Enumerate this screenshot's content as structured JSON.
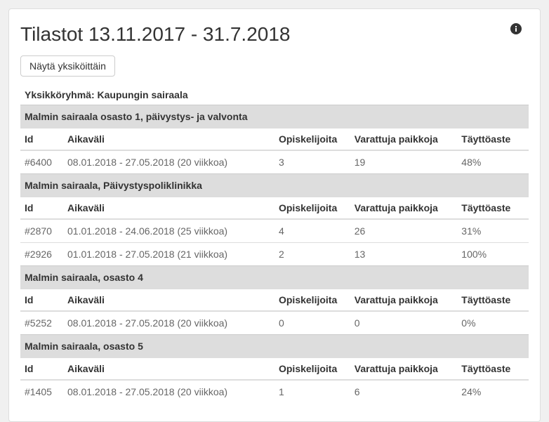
{
  "page": {
    "title": "Tilastot 13.11.2017 - 31.7.2018",
    "buttons": {
      "show_by_unit": "Näytä yksiköittäin"
    },
    "group_label": "Yksikköryhmä: Kaupungin sairaala"
  },
  "columns": {
    "id": "Id",
    "period": "Aikaväli",
    "students": "Opiskelijoita",
    "reserved": "Varattuja paikkoja",
    "fill": "Täyttöaste"
  },
  "sections": [
    {
      "name": "Malmin sairaala osasto 1, päivystys- ja valvonta",
      "rows": [
        {
          "id": "#6400",
          "period": "08.01.2018 - 27.05.2018 (20 viikkoa)",
          "students": "3",
          "reserved": "19",
          "fill": "48%"
        }
      ]
    },
    {
      "name": "Malmin sairaala, Päivystyspoliklinikka",
      "rows": [
        {
          "id": "#2870",
          "period": "01.01.2018 - 24.06.2018 (25 viikkoa)",
          "students": "4",
          "reserved": "26",
          "fill": "31%"
        },
        {
          "id": "#2926",
          "period": "01.01.2018 - 27.05.2018 (21 viikkoa)",
          "students": "2",
          "reserved": "13",
          "fill": "100%"
        }
      ]
    },
    {
      "name": "Malmin sairaala, osasto 4",
      "rows": [
        {
          "id": "#5252",
          "period": "08.01.2018 - 27.05.2018 (20 viikkoa)",
          "students": "0",
          "reserved": "0",
          "fill": "0%"
        }
      ]
    },
    {
      "name": "Malmin sairaala, osasto 5",
      "rows": [
        {
          "id": "#1405",
          "period": "08.01.2018 - 27.05.2018 (20 viikkoa)",
          "students": "1",
          "reserved": "6",
          "fill": "24%"
        }
      ]
    }
  ]
}
